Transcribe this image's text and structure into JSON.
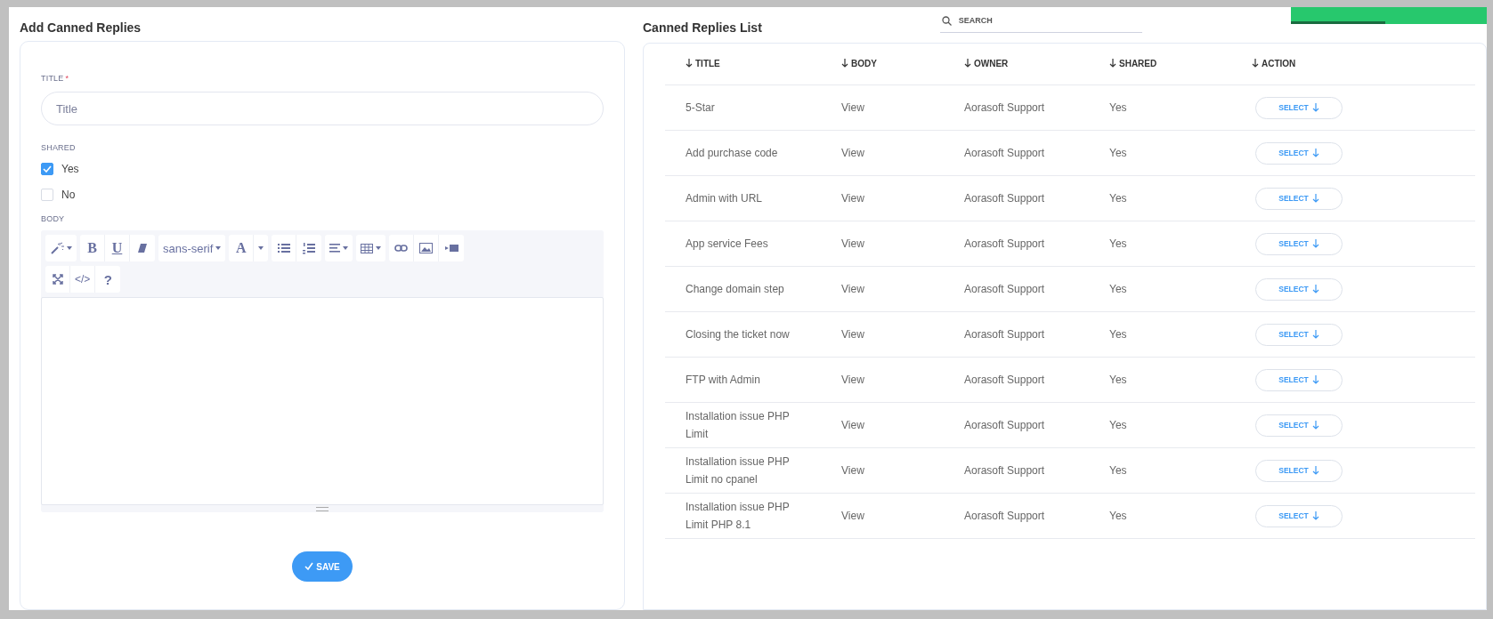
{
  "form": {
    "heading": "Add Canned Replies",
    "title_field": {
      "label": "TITLE",
      "required_mark": "*",
      "placeholder": "Title"
    },
    "shared": {
      "label": "SHARED",
      "options": [
        {
          "label": "Yes",
          "checked": true
        },
        {
          "label": "No",
          "checked": false
        }
      ]
    },
    "body": {
      "label": "BODY",
      "toolbar": [
        [
          {
            "kind": "magic",
            "caret": true
          }
        ],
        [
          {
            "kind": "text",
            "label": "B"
          },
          {
            "kind": "text",
            "label": "U"
          },
          {
            "kind": "eraser"
          }
        ],
        [
          {
            "kind": "font",
            "label": "sans-serif"
          }
        ],
        [
          {
            "kind": "text",
            "label": "A"
          },
          {
            "kind": "caret"
          }
        ],
        [
          {
            "kind": "ul"
          },
          {
            "kind": "ol"
          }
        ],
        [
          {
            "kind": "align",
            "caret": true
          }
        ],
        [
          {
            "kind": "table",
            "caret": true
          }
        ],
        [
          {
            "kind": "link"
          },
          {
            "kind": "picture"
          },
          {
            "kind": "video"
          }
        ],
        [
          {
            "kind": "expand"
          },
          {
            "kind": "text",
            "label": "</>"
          },
          {
            "kind": "text",
            "label": "?"
          }
        ]
      ]
    },
    "save": {
      "label": "SAVE"
    }
  },
  "list": {
    "heading": "Canned Replies List",
    "search": {
      "placeholder": "SEARCH"
    },
    "toast": {
      "level": 0.48
    },
    "columns": [
      "TITLE",
      "BODY",
      "OWNER",
      "SHARED",
      "ACTION"
    ],
    "rows": [
      {
        "title": "5-Star",
        "body": "View",
        "owner": "Aorasoft Support",
        "shared": "Yes",
        "action": "SELECT"
      },
      {
        "title": "Add purchase code",
        "body": "View",
        "owner": "Aorasoft Support",
        "shared": "Yes",
        "action": "SELECT"
      },
      {
        "title": "Admin with URL",
        "body": "View",
        "owner": "Aorasoft Support",
        "shared": "Yes",
        "action": "SELECT"
      },
      {
        "title": "App service Fees",
        "body": "View",
        "owner": "Aorasoft Support",
        "shared": "Yes",
        "action": "SELECT"
      },
      {
        "title": "Change domain step",
        "body": "View",
        "owner": "Aorasoft Support",
        "shared": "Yes",
        "action": "SELECT"
      },
      {
        "title": "Closing the ticket now",
        "body": "View",
        "owner": "Aorasoft Support",
        "shared": "Yes",
        "action": "SELECT"
      },
      {
        "title": "FTP with Admin",
        "body": "View",
        "owner": "Aorasoft Support",
        "shared": "Yes",
        "action": "SELECT"
      },
      {
        "title": "Installation issue PHP Limit",
        "body": "View",
        "owner": "Aorasoft Support",
        "shared": "Yes",
        "action": "SELECT"
      },
      {
        "title": "Installation issue PHP Limit no cpanel",
        "body": "View",
        "owner": "Aorasoft Support",
        "shared": "Yes",
        "action": "SELECT"
      },
      {
        "title": "Installation issue PHP Limit PHP 8.1",
        "body": "View",
        "owner": "Aorasoft Support",
        "shared": "Yes",
        "action": "SELECT"
      }
    ]
  }
}
